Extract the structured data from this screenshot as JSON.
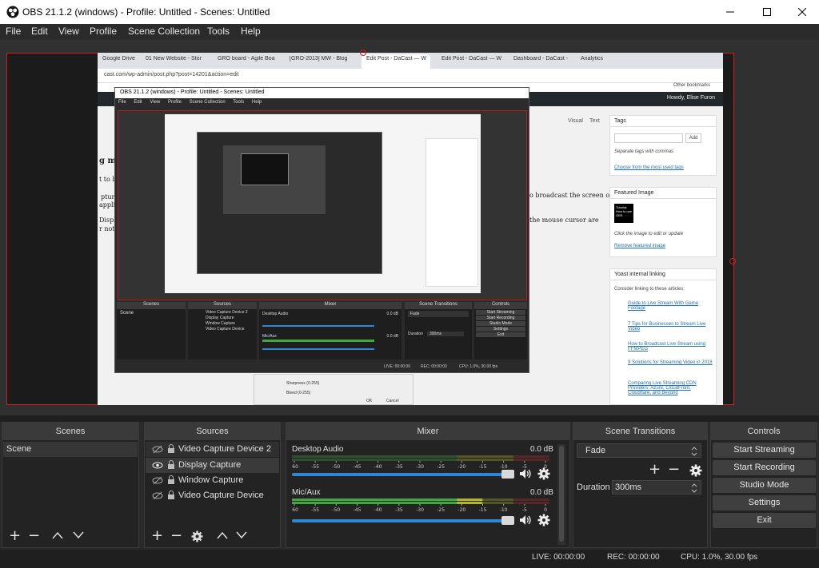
{
  "window": {
    "title": "OBS 21.1.2 (windows) - Profile: Untitled - Scenes: Untitled",
    "controls": [
      "minimize-icon",
      "maximize-icon",
      "close-icon"
    ]
  },
  "menu": [
    "File",
    "Edit",
    "View",
    "Profile",
    "Scene Collection",
    "Tools",
    "Help"
  ],
  "preview": {
    "browser_tabs": [
      "Google Drive",
      "01 New Website - Stor",
      "GRO board - Agile Boa",
      "[GRO-2013] MW - Blog",
      "Edit Post - DaCast — W",
      "Edit Post - DaCast — W",
      "Dashboard - DaCast -",
      "Analytics"
    ],
    "url": "cast.com/wp-admin/post.php?post=14201&action=edit",
    "other_bookmarks": "Other bookmarks",
    "wp_user": "Howdy, Elise Furon",
    "visual_tab": "Visual",
    "text_tab": "Text",
    "body_fragments": [
      "t to bro",
      "pture",
      "applic",
      "Displ",
      "r not, i",
      "g m",
      "o broadcast the screen of",
      "the mouse cursor are"
    ],
    "tags_box": {
      "title": "Tags",
      "add": "Add",
      "hint": "Separate tags with commas",
      "link": "Choose from the most used tags"
    },
    "featured_box": {
      "title": "Featured Image",
      "thumb_text": "Tutorial: How to use OBS",
      "hint": "Click the image to edit or update",
      "link": "Remove featured image"
    },
    "yoast_box": {
      "title": "Yoast internal linking",
      "intro": "Consider linking to these articles:",
      "items": [
        "Guide to Live Stream With Game Footage",
        "7 Tips for Businesses to Stream Live Video",
        "How to Broadcast Live Stream using FFMPEG",
        "9 Solutions for Streaming Video in 2018",
        "Comparing Live Streaming CDN Providers: Azure, CloudFront, Cloudflare, and Beyond"
      ]
    },
    "inner_obs": {
      "title": "OBS 21.1.2 (windows) - Profile: Untitled - Scenes: Untitled",
      "menu": [
        "File",
        "Edit",
        "View",
        "Profile",
        "Scene Collection",
        "Tools",
        "Help"
      ],
      "docks": [
        "Scenes",
        "Sources",
        "Mixer",
        "Scene Transitions",
        "Controls"
      ],
      "scene": "Scene",
      "sources": [
        "Video Capture Device 2",
        "Display Capture",
        "Window Capture",
        "Video Capture Device"
      ],
      "mixer": [
        {
          "name": "Desktop Audio",
          "db": "0.0 dB"
        },
        {
          "name": "Mic/Aux",
          "db": "0.0 dB"
        }
      ],
      "transition": "Fade",
      "duration_label": "Duration",
      "duration": "300ms",
      "buttons": [
        "Start Streaming",
        "Start Recording",
        "Studio Mode",
        "Settings",
        "Exit"
      ],
      "status": {
        "live": "LIVE: 00:00:00",
        "rec": "REC: 00:00:00",
        "cpu": "CPU: 1.0%, 30.00 fps"
      }
    },
    "bottom_fragments": [
      "Sharpness (0-255)",
      "Bleed (0-255)",
      "OK",
      "Cancel"
    ]
  },
  "docks": {
    "scenes": {
      "title": "Scenes",
      "items": [
        "Scene"
      ]
    },
    "sources": {
      "title": "Sources",
      "items": [
        {
          "label": "Video Capture Device 2",
          "visible": false
        },
        {
          "label": "Display Capture",
          "visible": true
        },
        {
          "label": "Window Capture",
          "visible": false
        },
        {
          "label": "Video Capture Device",
          "visible": false
        }
      ]
    },
    "mixer": {
      "title": "Mixer",
      "channels": [
        {
          "name": "Desktop Audio",
          "db": "0.0 dB",
          "level": 0.0,
          "volume": 1.0
        },
        {
          "name": "Mic/Aux",
          "db": "0.0 dB",
          "level": 0.74,
          "volume": 1.0
        }
      ],
      "ticks": [
        "-60",
        "-55",
        "-50",
        "-45",
        "-40",
        "-35",
        "-30",
        "-25",
        "-20",
        "-15",
        "-10",
        "-5",
        "0"
      ]
    },
    "transitions": {
      "title": "Scene Transitions",
      "selected": "Fade",
      "duration_label": "Duration",
      "duration": "300ms"
    },
    "controls": {
      "title": "Controls",
      "buttons": [
        "Start Streaming",
        "Start Recording",
        "Studio Mode",
        "Settings",
        "Exit"
      ]
    }
  },
  "status": {
    "live": "LIVE: 00:00:00",
    "rec": "REC: 00:00:00",
    "cpu": "CPU: 1.0%, 30.00 fps"
  },
  "colors": {
    "accent_red": "#cc2020",
    "meter_green": "#3fa83f",
    "meter_yellow": "#b4b431",
    "meter_red": "#b43030",
    "slider_blue": "#2e86d6"
  }
}
